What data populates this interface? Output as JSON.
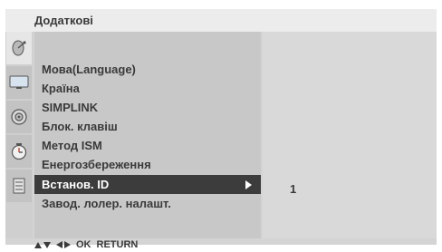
{
  "menu": {
    "title": "Додаткові",
    "items": [
      {
        "label": "Мова(Language)",
        "selected": false
      },
      {
        "label": "Країна",
        "selected": false
      },
      {
        "label": "SIMPLINK",
        "selected": false
      },
      {
        "label": "Блок. клавіш",
        "selected": false
      },
      {
        "label": "Метод ISM",
        "selected": false
      },
      {
        "label": "Енергозбереження",
        "selected": false
      },
      {
        "label": "Встанов. ID",
        "selected": true
      },
      {
        "label": "Завод. лолер. налашт.",
        "selected": false
      }
    ]
  },
  "submenu": {
    "value": "1"
  },
  "icons": [
    {
      "name": "satellite-dish-icon",
      "active": true
    },
    {
      "name": "tv-screen-icon",
      "active": false
    },
    {
      "name": "speaker-icon",
      "active": false
    },
    {
      "name": "clock-icon",
      "active": false
    },
    {
      "name": "options-icon",
      "active": false
    }
  ],
  "footer": {
    "ok_label": "OK",
    "return_label": "RETURN"
  }
}
